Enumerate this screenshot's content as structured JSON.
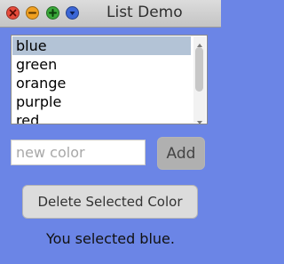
{
  "window": {
    "title": "List Demo",
    "buttons": [
      "close-icon",
      "minimize-icon",
      "maximize-icon",
      "menu-icon"
    ]
  },
  "list": {
    "items": [
      "blue",
      "green",
      "orange",
      "purple",
      "red"
    ],
    "selected": "blue"
  },
  "entry": {
    "placeholder": "new color",
    "value": ""
  },
  "add_button": {
    "label": "Add"
  },
  "delete_button": {
    "label": "Delete Selected Color"
  },
  "status": {
    "text": "You selected blue."
  },
  "colors": {
    "background": "#6b85e6",
    "selection": "#b3c3d6"
  }
}
